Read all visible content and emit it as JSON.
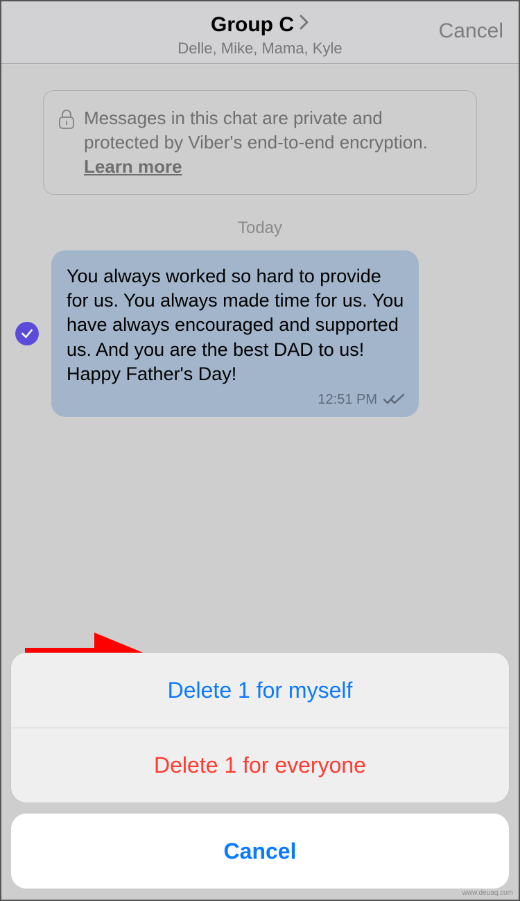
{
  "header": {
    "title": "Group C",
    "subtitle": "Delle, Mike, Mama, Kyle",
    "cancel": "Cancel"
  },
  "notice": {
    "text_prefix": "Messages in this chat are private and protected by Viber's end-to-end encryption. ",
    "learn_more": "Learn more"
  },
  "date_separator": "Today",
  "message": {
    "text": "You always worked so hard to provide for us. You always made time for us. You have always encouraged and supported us. And you are the best DAD to us! Happy Father's Day!",
    "time": "12:51 PM",
    "status": "read",
    "selected": true,
    "outgoing": true
  },
  "action_sheet": {
    "option_self": "Delete 1 for myself",
    "option_everyone": "Delete 1 for everyone",
    "cancel": "Cancel"
  },
  "watermark": "www.deuaq.com",
  "colors": {
    "accent_purple": "#5b4bd9",
    "bubble": "#a3b5cb",
    "ios_blue": "#0a7aff",
    "ios_red": "#ff3b30"
  }
}
